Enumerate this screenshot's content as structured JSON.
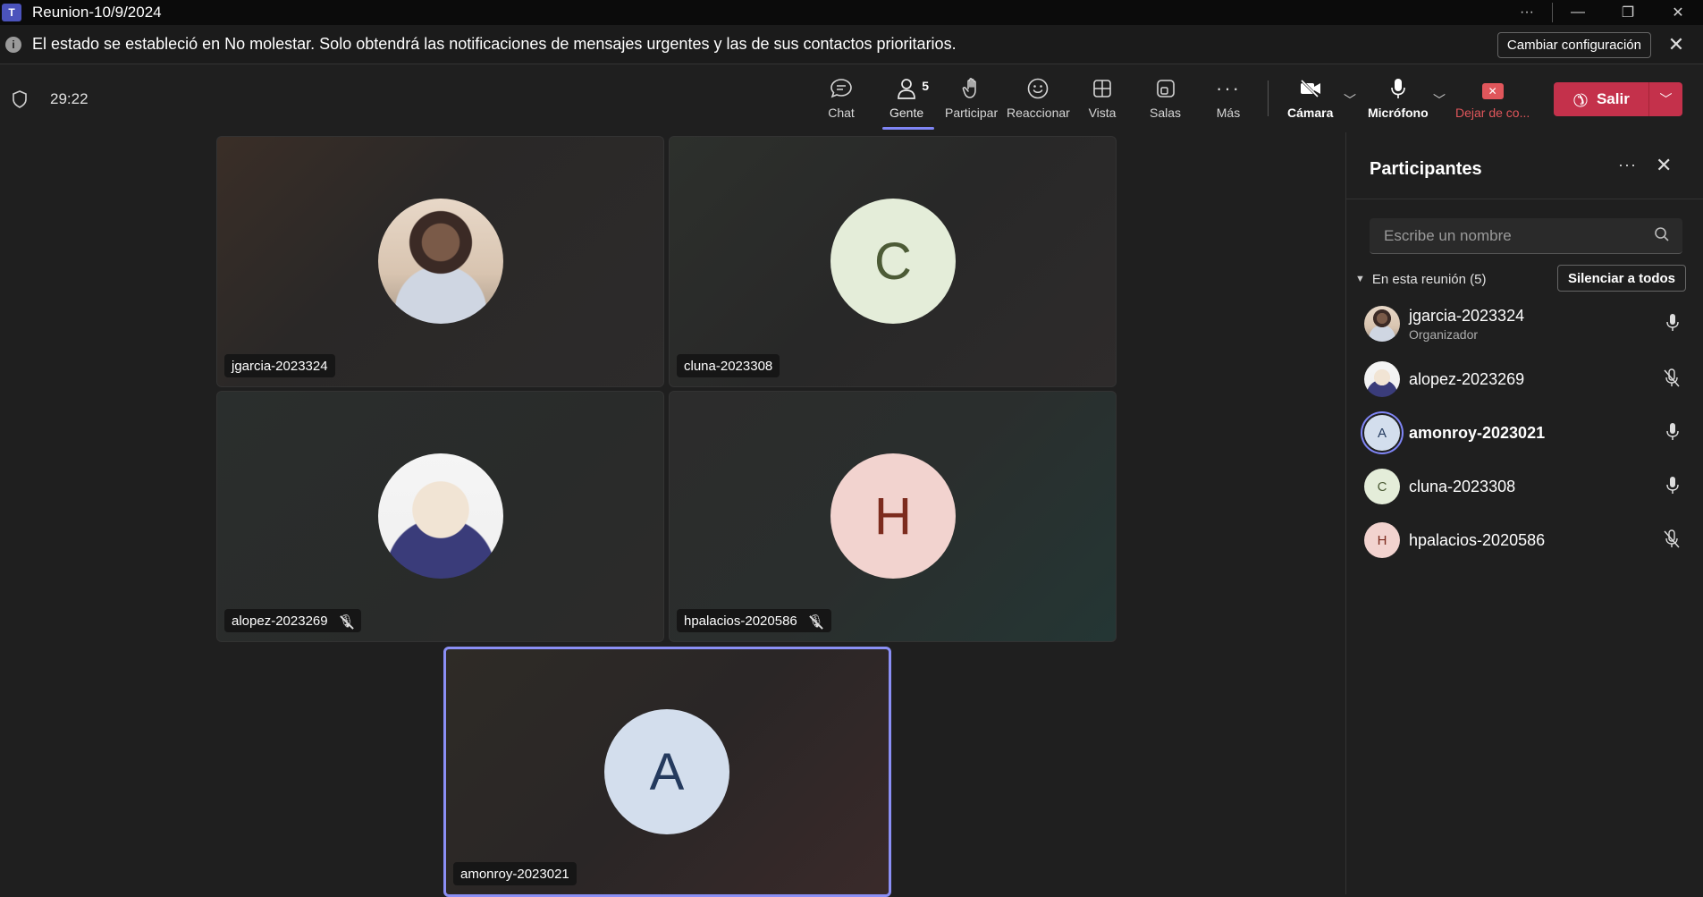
{
  "window": {
    "title": "Reunion-10/9/2024"
  },
  "notice": {
    "text": "El estado se estableció en No molestar. Solo obtendrá las notificaciones de mensajes urgentes y las de sus contactos prioritarios.",
    "button": "Cambiar configuración"
  },
  "toolbar": {
    "timer": "29:22",
    "chat": "Chat",
    "people": "Gente",
    "people_count": "5",
    "raise": "Participar",
    "react": "Reaccionar",
    "view": "Vista",
    "rooms": "Salas",
    "more": "Más",
    "camera": "Cámara",
    "mic": "Micrófono",
    "share": "Dejar de co...",
    "leave": "Salir"
  },
  "tiles": [
    {
      "name": "jgarcia-2023324",
      "initial": "",
      "muted": false
    },
    {
      "name": "cluna-2023308",
      "initial": "C",
      "muted": false
    },
    {
      "name": "alopez-2023269",
      "initial": "",
      "muted": true
    },
    {
      "name": "hpalacios-2020586",
      "initial": "H",
      "muted": true
    },
    {
      "name": "amonroy-2023021",
      "initial": "A",
      "muted": false
    }
  ],
  "panel": {
    "title": "Participantes",
    "search_placeholder": "Escribe un nombre",
    "section": "En esta reunión (5)",
    "mute_all": "Silenciar a todos",
    "participants": [
      {
        "name": "jgarcia-2023324",
        "role": "Organizador",
        "initial": "",
        "muted": false
      },
      {
        "name": "alopez-2023269",
        "role": "",
        "initial": "",
        "muted": true
      },
      {
        "name": "amonroy-2023021",
        "role": "",
        "initial": "A",
        "muted": false
      },
      {
        "name": "cluna-2023308",
        "role": "",
        "initial": "C",
        "muted": false
      },
      {
        "name": "hpalacios-2020586",
        "role": "",
        "initial": "H",
        "muted": true
      }
    ]
  },
  "colors": {
    "accent": "#7f85f5",
    "leave": "#c4314b",
    "stop_share": "#e0565b"
  }
}
